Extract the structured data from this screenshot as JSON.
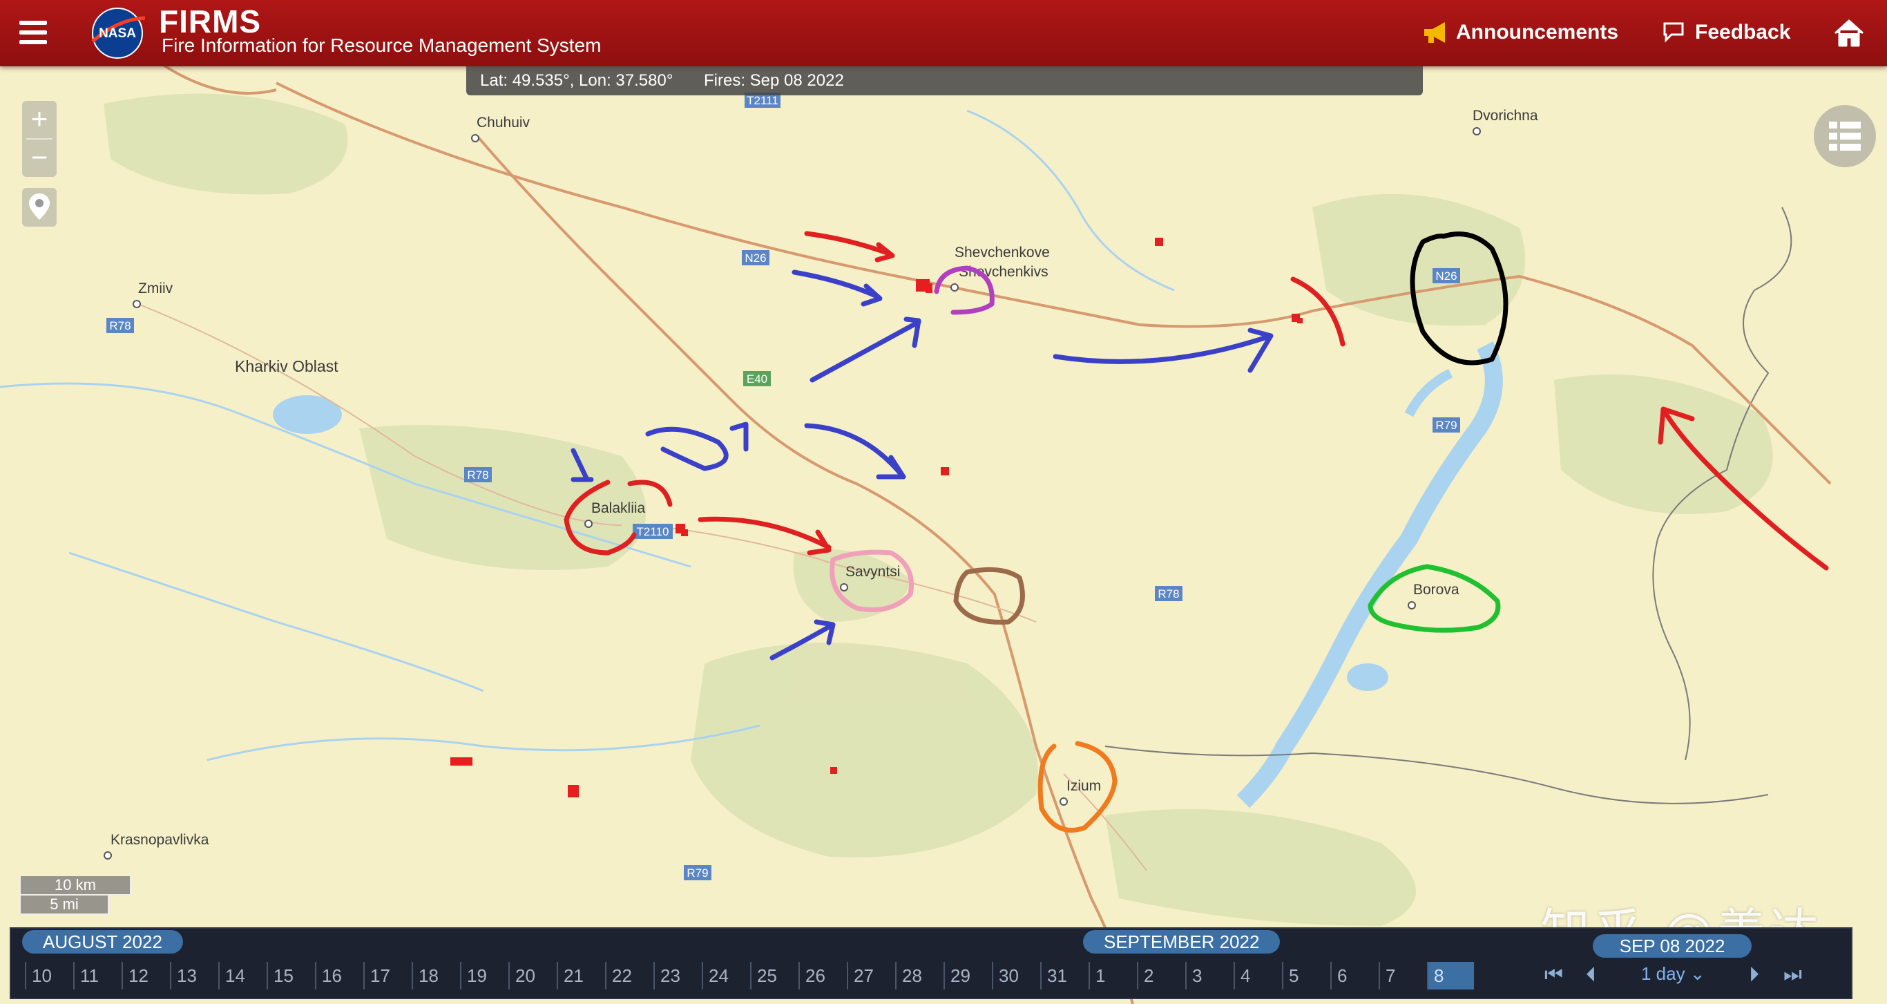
{
  "header": {
    "title": "FIRMS",
    "subtitle": "Fire Information for Resource Management System",
    "logo_text": "NASA",
    "announcements": "Announcements",
    "feedback": "Feedback",
    "colors": {
      "header_bg": "#a01212",
      "text": "#ffffff",
      "announce_icon": "#f5b800"
    }
  },
  "info_bar": {
    "coords": "Lat: 49.535°, Lon: 37.580°",
    "fires": "Fires: Sep 08 2022"
  },
  "map": {
    "places": [
      "Chuhuiv",
      "Dvorichna",
      "Zmiiv",
      "Kharkiv Oblast",
      "Shevchenkove",
      "Shevchenkivs",
      "Balakliia",
      "Savyntsi",
      "Borova",
      "Izium",
      "Krasnopavlivka"
    ],
    "road_shields": [
      "T2111",
      "N26",
      "R78",
      "E40",
      "R78",
      "T2110",
      "R79",
      "R78",
      "N26",
      "R79"
    ],
    "scale": {
      "km": "10 km",
      "mi": "5 mi"
    },
    "colors": {
      "land": "#f6f0c8",
      "forest": "#d9dfb0",
      "water": "#aad3f0",
      "road": "#d79a6f",
      "fire": "#e51f1f"
    }
  },
  "timeline": {
    "month1": "AUGUST 2022",
    "month2": "SEPTEMBER 2022",
    "days_aug": [
      "10",
      "11",
      "12",
      "13",
      "14",
      "15",
      "16",
      "17",
      "18",
      "19",
      "20",
      "21",
      "22",
      "23",
      "24",
      "25",
      "26",
      "27",
      "28",
      "29",
      "30",
      "31"
    ],
    "days_sep": [
      "1",
      "2",
      "3",
      "4",
      "5",
      "6",
      "7",
      "8"
    ],
    "selected_day": "8",
    "current_date": "SEP 08 2022",
    "period": "1 day"
  },
  "watermark": "知乎 @善达"
}
